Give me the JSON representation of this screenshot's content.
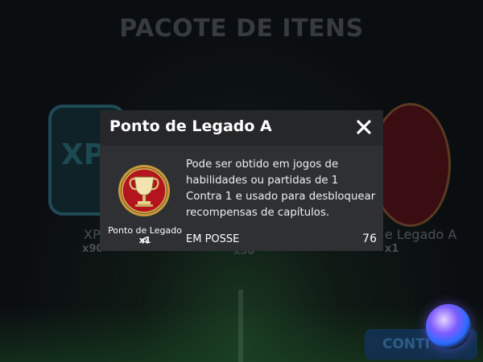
{
  "background": {
    "title": "PACOTE DE ITENS",
    "left_card_text": "XP",
    "left_card_label": "XP",
    "left_card_qty": "x90",
    "right_card_label": "e Legado A",
    "right_card_qty": "x1",
    "center_qty": "x30",
    "continue_label": "CONTI"
  },
  "modal": {
    "title": "Ponto de Legado A",
    "close_icon": "close-icon",
    "item": {
      "name": "Ponto de Legado A",
      "quantity": "x1",
      "icon": "trophy-icon"
    },
    "description": "Pode ser obtido em jogos de habilidades ou partidas de 1 Contra 1 e usado para desbloquear recompensas de capítulos.",
    "owned_label": "EM POSSE",
    "owned_value": "76"
  },
  "colors": {
    "modal_bg": "#2e3033",
    "header_bg": "#262729",
    "badge_red": "#b3141e",
    "badge_gold": "#c99a3c"
  }
}
